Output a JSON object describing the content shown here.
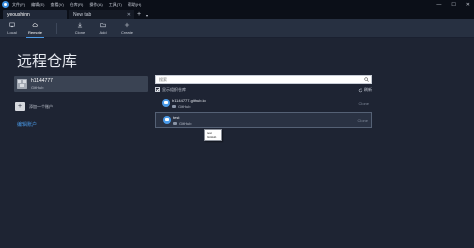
{
  "menubar": {
    "items": [
      "文件(F)",
      "编辑(E)",
      "查看(V)",
      "仓库(R)",
      "操作(A)",
      "工具(T)",
      "帮助(H)"
    ],
    "controls": [
      "—",
      "☐",
      "✕"
    ]
  },
  "tabs": {
    "active": "yeoushinn",
    "inactive": "New tab",
    "add": "+",
    "dropdown": "▾",
    "close": "✕"
  },
  "toolbar": {
    "local": "Local",
    "remote": "Remote",
    "clone": "Clone",
    "add": "Add",
    "create": "Create"
  },
  "page": {
    "title": "远程仓库"
  },
  "account": {
    "name": "h1144777",
    "host": "GitHub"
  },
  "add_account": {
    "icon": "+",
    "label": "添加一个账户"
  },
  "manage_link": "编辑账户",
  "search": {
    "placeholder": "搜索"
  },
  "filter": {
    "label": "显示组织仓库",
    "refresh": "刷新"
  },
  "repos": [
    {
      "name": "h1144777.github.io",
      "host": "GitHub",
      "action": "Clone"
    },
    {
      "name": "test",
      "host": "GitHub",
      "action": "Clone"
    }
  ],
  "tooltip": {
    "line1": "test",
    "line2": "GitHub"
  },
  "colors": {
    "accent": "#4a9ae8",
    "background": "#1e2433",
    "toolbar": "#273041"
  }
}
